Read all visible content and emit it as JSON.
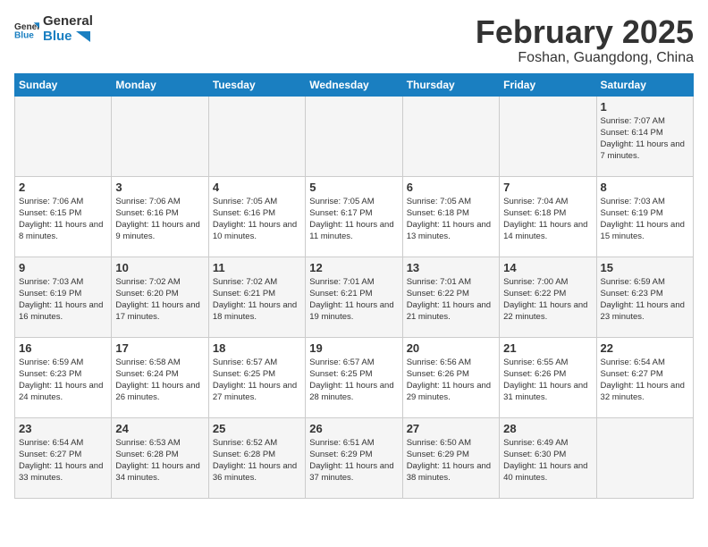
{
  "logo": {
    "general": "General",
    "blue": "Blue"
  },
  "title": "February 2025",
  "subtitle": "Foshan, Guangdong, China",
  "weekdays": [
    "Sunday",
    "Monday",
    "Tuesday",
    "Wednesday",
    "Thursday",
    "Friday",
    "Saturday"
  ],
  "weeks": [
    [
      {
        "day": "",
        "info": ""
      },
      {
        "day": "",
        "info": ""
      },
      {
        "day": "",
        "info": ""
      },
      {
        "day": "",
        "info": ""
      },
      {
        "day": "",
        "info": ""
      },
      {
        "day": "",
        "info": ""
      },
      {
        "day": "1",
        "info": "Sunrise: 7:07 AM\nSunset: 6:14 PM\nDaylight: 11 hours and 7 minutes."
      }
    ],
    [
      {
        "day": "2",
        "info": "Sunrise: 7:06 AM\nSunset: 6:15 PM\nDaylight: 11 hours and 8 minutes."
      },
      {
        "day": "3",
        "info": "Sunrise: 7:06 AM\nSunset: 6:16 PM\nDaylight: 11 hours and 9 minutes."
      },
      {
        "day": "4",
        "info": "Sunrise: 7:05 AM\nSunset: 6:16 PM\nDaylight: 11 hours and 10 minutes."
      },
      {
        "day": "5",
        "info": "Sunrise: 7:05 AM\nSunset: 6:17 PM\nDaylight: 11 hours and 11 minutes."
      },
      {
        "day": "6",
        "info": "Sunrise: 7:05 AM\nSunset: 6:18 PM\nDaylight: 11 hours and 13 minutes."
      },
      {
        "day": "7",
        "info": "Sunrise: 7:04 AM\nSunset: 6:18 PM\nDaylight: 11 hours and 14 minutes."
      },
      {
        "day": "8",
        "info": "Sunrise: 7:03 AM\nSunset: 6:19 PM\nDaylight: 11 hours and 15 minutes."
      }
    ],
    [
      {
        "day": "9",
        "info": "Sunrise: 7:03 AM\nSunset: 6:19 PM\nDaylight: 11 hours and 16 minutes."
      },
      {
        "day": "10",
        "info": "Sunrise: 7:02 AM\nSunset: 6:20 PM\nDaylight: 11 hours and 17 minutes."
      },
      {
        "day": "11",
        "info": "Sunrise: 7:02 AM\nSunset: 6:21 PM\nDaylight: 11 hours and 18 minutes."
      },
      {
        "day": "12",
        "info": "Sunrise: 7:01 AM\nSunset: 6:21 PM\nDaylight: 11 hours and 19 minutes."
      },
      {
        "day": "13",
        "info": "Sunrise: 7:01 AM\nSunset: 6:22 PM\nDaylight: 11 hours and 21 minutes."
      },
      {
        "day": "14",
        "info": "Sunrise: 7:00 AM\nSunset: 6:22 PM\nDaylight: 11 hours and 22 minutes."
      },
      {
        "day": "15",
        "info": "Sunrise: 6:59 AM\nSunset: 6:23 PM\nDaylight: 11 hours and 23 minutes."
      }
    ],
    [
      {
        "day": "16",
        "info": "Sunrise: 6:59 AM\nSunset: 6:23 PM\nDaylight: 11 hours and 24 minutes."
      },
      {
        "day": "17",
        "info": "Sunrise: 6:58 AM\nSunset: 6:24 PM\nDaylight: 11 hours and 26 minutes."
      },
      {
        "day": "18",
        "info": "Sunrise: 6:57 AM\nSunset: 6:25 PM\nDaylight: 11 hours and 27 minutes."
      },
      {
        "day": "19",
        "info": "Sunrise: 6:57 AM\nSunset: 6:25 PM\nDaylight: 11 hours and 28 minutes."
      },
      {
        "day": "20",
        "info": "Sunrise: 6:56 AM\nSunset: 6:26 PM\nDaylight: 11 hours and 29 minutes."
      },
      {
        "day": "21",
        "info": "Sunrise: 6:55 AM\nSunset: 6:26 PM\nDaylight: 11 hours and 31 minutes."
      },
      {
        "day": "22",
        "info": "Sunrise: 6:54 AM\nSunset: 6:27 PM\nDaylight: 11 hours and 32 minutes."
      }
    ],
    [
      {
        "day": "23",
        "info": "Sunrise: 6:54 AM\nSunset: 6:27 PM\nDaylight: 11 hours and 33 minutes."
      },
      {
        "day": "24",
        "info": "Sunrise: 6:53 AM\nSunset: 6:28 PM\nDaylight: 11 hours and 34 minutes."
      },
      {
        "day": "25",
        "info": "Sunrise: 6:52 AM\nSunset: 6:28 PM\nDaylight: 11 hours and 36 minutes."
      },
      {
        "day": "26",
        "info": "Sunrise: 6:51 AM\nSunset: 6:29 PM\nDaylight: 11 hours and 37 minutes."
      },
      {
        "day": "27",
        "info": "Sunrise: 6:50 AM\nSunset: 6:29 PM\nDaylight: 11 hours and 38 minutes."
      },
      {
        "day": "28",
        "info": "Sunrise: 6:49 AM\nSunset: 6:30 PM\nDaylight: 11 hours and 40 minutes."
      },
      {
        "day": "",
        "info": ""
      }
    ]
  ]
}
